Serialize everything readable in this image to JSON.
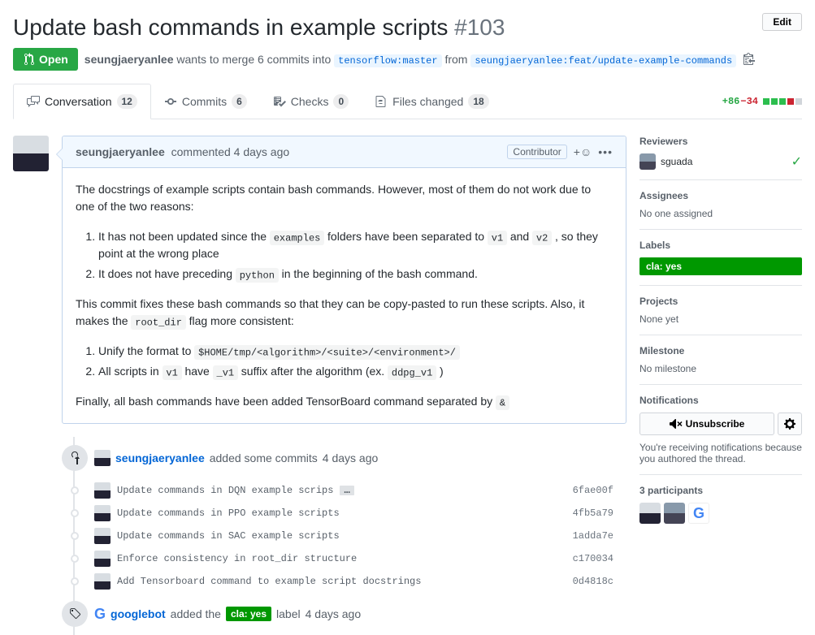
{
  "title": "Update bash commands in example scripts",
  "issue_number": "#103",
  "edit_label": "Edit",
  "state": "Open",
  "pr_author": "seungjaeryanlee",
  "merge_text_1": "wants to merge 6 commits into",
  "base_branch": "tensorflow:master",
  "merge_text_2": "from",
  "head_branch": "seungjaeryanlee:feat/update-example-commands",
  "tabs": {
    "conversation": "Conversation",
    "conversation_count": "12",
    "commits": "Commits",
    "commits_count": "6",
    "checks": "Checks",
    "checks_count": "0",
    "files": "Files changed",
    "files_count": "18"
  },
  "diffstat": {
    "additions": "+86",
    "deletions": "−34"
  },
  "comment": {
    "author": "seungjaeryanlee",
    "action": "commented",
    "time": "4 days ago",
    "badge": "Contributor",
    "p1": "The docstrings of example scripts contain bash commands. However, most of them do not work due to one of the two reasons:",
    "li1_a": "It has not been updated since the ",
    "li1_code1": "examples",
    "li1_b": " folders have been separated to ",
    "li1_code2": "v1",
    "li1_c": " and ",
    "li1_code3": "v2",
    "li1_d": " , so they point at the wrong place",
    "li2_a": "It does not have preceding ",
    "li2_code1": "python",
    "li2_b": " in the beginning of the bash command.",
    "p2_a": "This commit fixes these bash commands so that they can be copy-pasted to run these scripts. Also, it makes the ",
    "p2_code": "root_dir",
    "p2_b": " flag more consistent:",
    "li3_a": "Unify the format to ",
    "li3_code": "$HOME/tmp/<algorithm>/<suite>/<environment>/",
    "li4_a": "All scripts in ",
    "li4_code1": "v1",
    "li4_b": " have ",
    "li4_code2": "_v1",
    "li4_c": " suffix after the algorithm (ex. ",
    "li4_code3": "ddpg_v1",
    "li4_d": " )",
    "p3_a": "Finally, all bash commands have been added TensorBoard command separated by ",
    "p3_code": "&"
  },
  "commits_header": {
    "author": "seungjaeryanlee",
    "text": "added some commits",
    "time": "4 days ago"
  },
  "commit_list": [
    {
      "msg": "Update commands in DQN example scrips",
      "sha": "6fae00f",
      "ellipsis": true
    },
    {
      "msg": "Update commands in PPO example scripts",
      "sha": "4fb5a79"
    },
    {
      "msg": "Update commands in SAC example scripts",
      "sha": "1adda7e"
    },
    {
      "msg": "Enforce consistency in root_dir structure",
      "sha": "c170034"
    },
    {
      "msg": "Add Tensorboard command to example script docstrings",
      "sha": "0d4818c"
    }
  ],
  "label_event": {
    "author": "googlebot",
    "action_a": "added the",
    "label": "cla: yes",
    "action_b": "label",
    "time": "4 days ago"
  },
  "sidebar": {
    "reviewers_h": "Reviewers",
    "reviewer": "sguada",
    "assignees_h": "Assignees",
    "assignees_v": "No one assigned",
    "labels_h": "Labels",
    "labels_v": "cla: yes",
    "projects_h": "Projects",
    "projects_v": "None yet",
    "milestone_h": "Milestone",
    "milestone_v": "No milestone",
    "notifications_h": "Notifications",
    "unsubscribe": "Unsubscribe",
    "notif_desc": "You're receiving notifications because you authored the thread.",
    "participants_h": "3 participants"
  }
}
